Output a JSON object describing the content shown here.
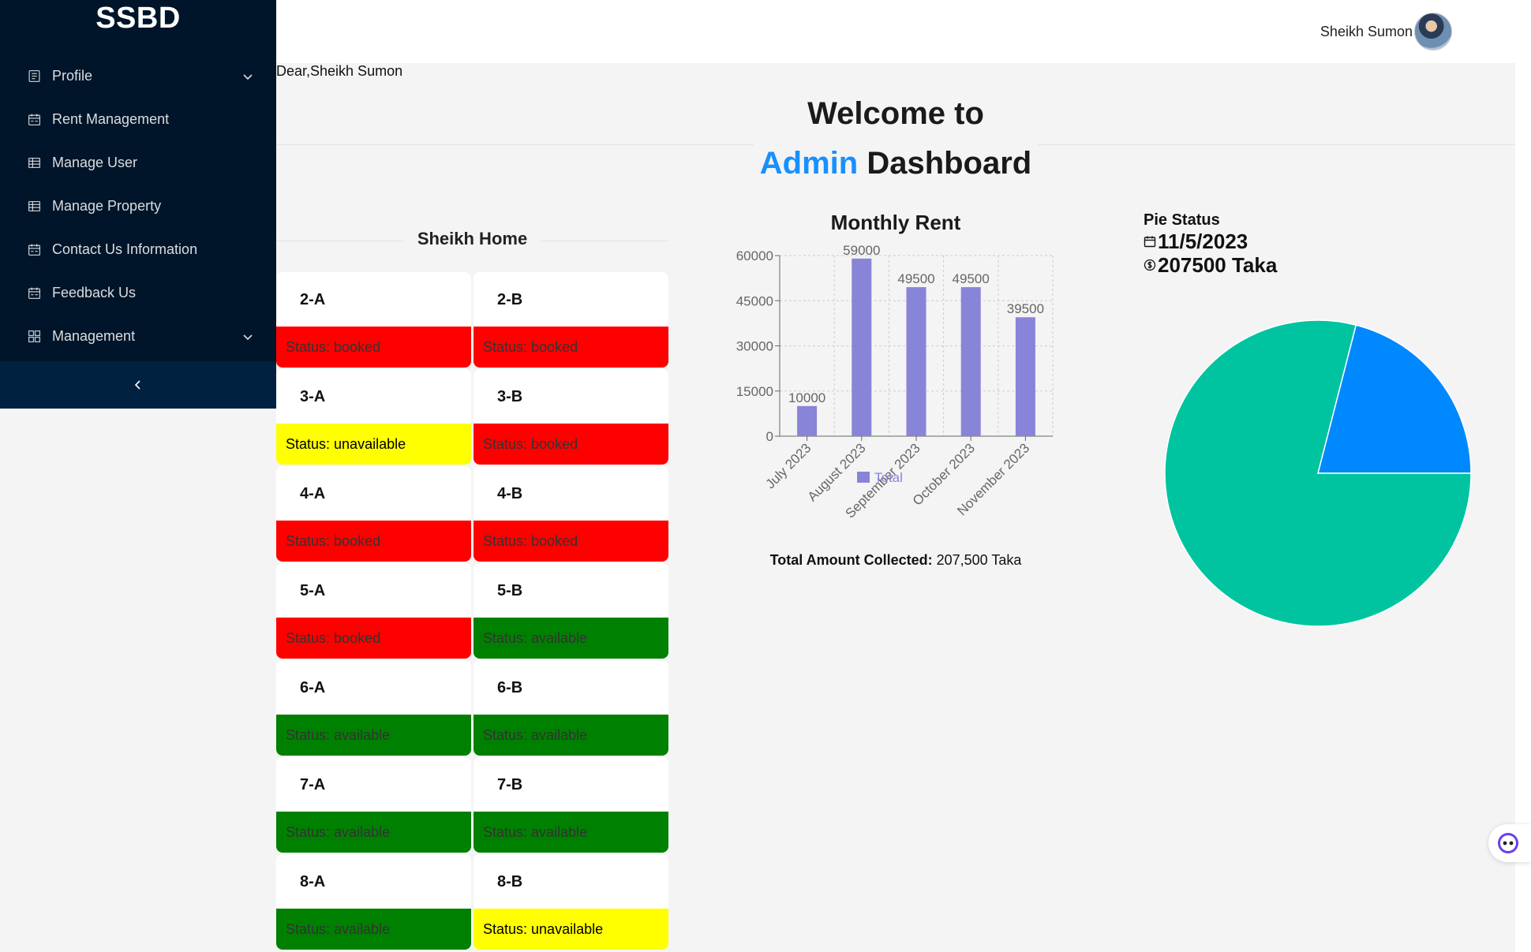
{
  "sidebar": {
    "brand": "SSBD",
    "items": [
      {
        "label": "Profile",
        "icon": "profile-icon",
        "has_chevron": true
      },
      {
        "label": "Rent Management",
        "icon": "calendar-icon",
        "has_chevron": false
      },
      {
        "label": "Manage User",
        "icon": "table-icon",
        "has_chevron": false
      },
      {
        "label": "Manage Property",
        "icon": "table-icon",
        "has_chevron": false
      },
      {
        "label": "Contact Us Information",
        "icon": "calendar-icon",
        "has_chevron": false
      },
      {
        "label": "Feedback Us",
        "icon": "calendar-icon",
        "has_chevron": false
      },
      {
        "label": "Management",
        "icon": "appstore-icon",
        "has_chevron": true
      }
    ],
    "collapse_glyph": "<",
    "bg_color": "#001529"
  },
  "header": {
    "user_name": "Sheikh Sumon",
    "greeting": "Dear,Sheikh Sumon"
  },
  "welcome": {
    "line1": "Welcome to",
    "admin": "Admin",
    "dashboard": "Dashboard",
    "accent_color": "#1890ff"
  },
  "property": {
    "title": "Sheikh Home",
    "units": [
      {
        "name": "2-A",
        "status_text": "Status: booked",
        "status": "booked"
      },
      {
        "name": "2-B",
        "status_text": "Status: booked",
        "status": "booked"
      },
      {
        "name": "3-A",
        "status_text": "Status: unavailable",
        "status": "unavailable"
      },
      {
        "name": "3-B",
        "status_text": "Status: booked",
        "status": "booked"
      },
      {
        "name": "4-A",
        "status_text": "Status: booked",
        "status": "booked"
      },
      {
        "name": "4-B",
        "status_text": "Status: booked",
        "status": "booked"
      },
      {
        "name": "5-A",
        "status_text": "Status: booked",
        "status": "booked"
      },
      {
        "name": "5-B",
        "status_text": "Status: available",
        "status": "available"
      },
      {
        "name": "6-A",
        "status_text": "Status: available",
        "status": "available"
      },
      {
        "name": "6-B",
        "status_text": "Status: available",
        "status": "available"
      },
      {
        "name": "7-A",
        "status_text": "Status: available",
        "status": "available"
      },
      {
        "name": "7-B",
        "status_text": "Status: available",
        "status": "available"
      },
      {
        "name": "8-A",
        "status_text": "Status: available",
        "status": "available"
      },
      {
        "name": "8-B",
        "status_text": "Status: unavailable",
        "status": "unavailable"
      }
    ],
    "status_colors": {
      "booked": "#ff0000",
      "available": "#008000",
      "unavailable": "#ffff00"
    }
  },
  "rent_chart": {
    "title": "Monthly Rent",
    "total_label": "Total Amount Collected:",
    "total_value": "207,500 Taka"
  },
  "chart_data": {
    "type": "bar",
    "categories": [
      "July 2023",
      "August 2023",
      "September 2023",
      "October 2023",
      "November 2023"
    ],
    "series": [
      {
        "name": "Total",
        "values": [
          10000,
          59000,
          49500,
          49500,
          39500
        ]
      }
    ],
    "ylim": [
      0,
      60000
    ],
    "yticks": [
      "0",
      "15000",
      "30000",
      "45000",
      "60000"
    ],
    "data_labels": [
      "10000",
      "59000",
      "49500",
      "49500",
      "39500"
    ],
    "grid": true,
    "legend": "bottom-center",
    "bar_color": "#8884d8"
  },
  "pie": {
    "label": "Pie Status",
    "date": "11/5/2023",
    "amount": "207500 Taka",
    "slices": [
      {
        "value": 0.21,
        "color": "#0088fe"
      },
      {
        "value": 0.79,
        "color": "#00c49f"
      }
    ]
  }
}
